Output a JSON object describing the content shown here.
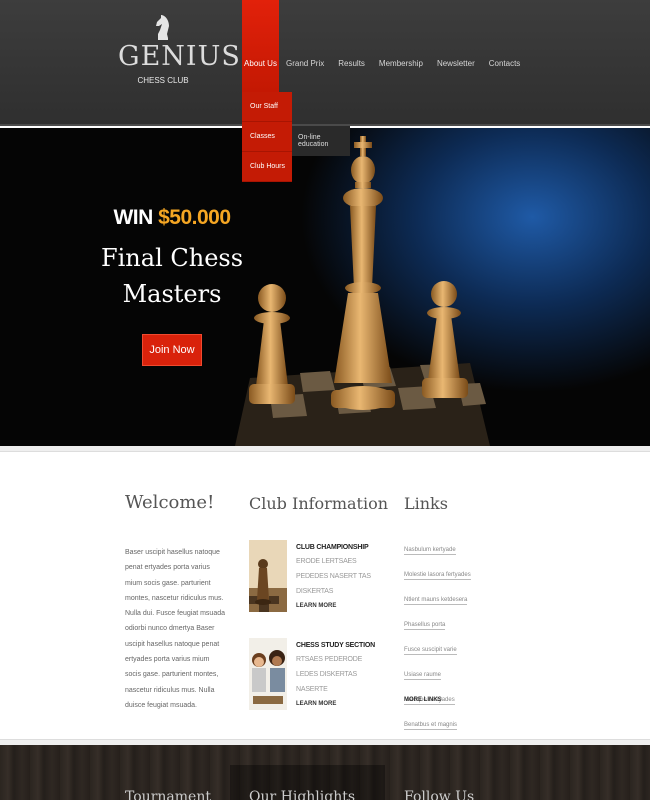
{
  "logo": {
    "title": "GENIUS",
    "subtitle": "CHESS CLUB"
  },
  "nav": [
    {
      "label": "About Us"
    },
    {
      "label": "Grand Prix"
    },
    {
      "label": "Results"
    },
    {
      "label": "Membership"
    },
    {
      "label": "Newsletter"
    },
    {
      "label": "Contacts"
    }
  ],
  "dropdown": [
    {
      "label": "Our Staff"
    },
    {
      "label": "Classes"
    },
    {
      "label": "Club Hours"
    }
  ],
  "subdropdown": {
    "label": "On-line education"
  },
  "hero": {
    "win_prefix": "WIN",
    "win_amount": "$50.000",
    "title_line1": "Final Chess",
    "title_line2": "Masters",
    "button": "Join Now"
  },
  "welcome": {
    "title": "Welcome!",
    "text": "Baser uscipit hasellus natoque penat ertyades porta varius mium socis gase. parturient montes, nascetur ridiculus mus. Nulla dui. Fusce feugiat msuada odiorbi nunco dmertya Baser uscipit hasellus natoque penat ertyades porta varius mium socis gase. parturient montes, nascetur ridiculus mus. Nulla duisce feugiat msuada."
  },
  "club": {
    "title": "Club Information",
    "items": [
      {
        "heading": "CLUB CHAMPIONSHIP",
        "desc": "ERODE LERTSAES PEDEDES NASERT TAS DISKERTAS",
        "more": "LEARN MORE"
      },
      {
        "heading": "CHESS STUDY SECTION",
        "desc": "RTSAES PEDERODE LEDES DISKERTAS NASERTE",
        "more": "LEARN MORE"
      }
    ]
  },
  "links": {
    "title": "Links",
    "items": [
      "Nasbulum kertyade",
      "Molestie lasora fertyades",
      "Ntlent mauns ketdesera",
      "Phasellus porta",
      "Fusce suscipit varie",
      "Usiase raume",
      "Natoque nertyades",
      "Benatbus et magnis"
    ],
    "more": "MORE LINKS"
  },
  "footer": {
    "titles": [
      "Tournament",
      "Our Highlights",
      "Follow Us"
    ]
  },
  "colors": {
    "accent": "#d9220b",
    "gold": "#f5a623",
    "header_bg": "#363636"
  }
}
